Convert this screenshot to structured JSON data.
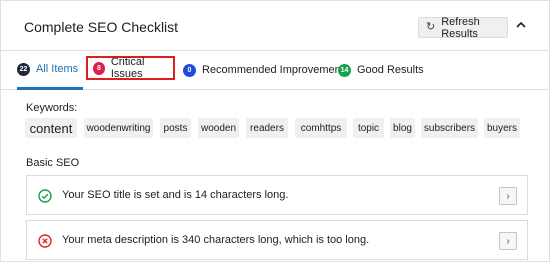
{
  "header": {
    "title": "Complete SEO Checklist",
    "refresh_label": "Refresh Results",
    "refresh_icon": "refresh-icon",
    "collapse_icon": "chevron-up-icon"
  },
  "tabs": [
    {
      "count": "22",
      "label": "All Items",
      "active": true,
      "badge_color": "#1e2a3a"
    },
    {
      "count": "8",
      "label": "Critical Issues",
      "badge_color": "#e11d48"
    },
    {
      "count": "0",
      "label": "Recommended Improvements",
      "badge_color": "#1d4ed8"
    },
    {
      "count": "14",
      "label": "Good Results",
      "badge_color": "#16a34a"
    }
  ],
  "keywords": {
    "label": "Keywords:",
    "items": [
      "content",
      "woodenwriting",
      "posts",
      "wooden",
      "readers",
      "comhttps",
      "topic",
      "blog",
      "subscribers",
      "buyers"
    ]
  },
  "basic_seo": {
    "label": "Basic SEO",
    "items": [
      {
        "status": "good",
        "icon": "check-circle-icon",
        "text": "Your SEO title is set and is 14 characters long.",
        "color": "#16a34a"
      },
      {
        "status": "error",
        "icon": "x-circle-icon",
        "text": "Your meta description is 340 characters long, which is too long.",
        "color": "#dc2626"
      }
    ]
  },
  "colors": {
    "accent": "#2271b1",
    "highlight_border": "#e11d1d"
  }
}
